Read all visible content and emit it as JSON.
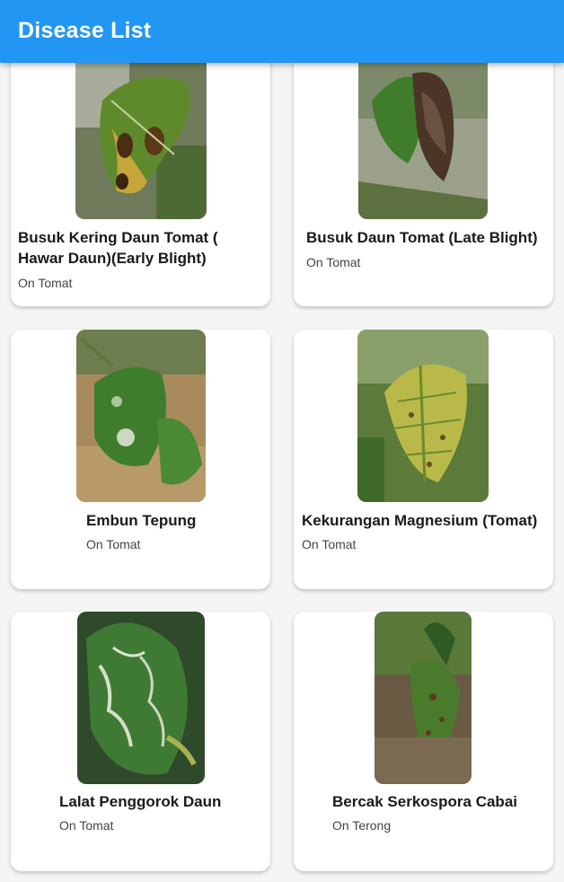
{
  "appbar": {
    "title": "Disease List"
  },
  "cards": [
    {
      "title": "Busuk Kering Daun Tomat ( Hawar Daun)(Early Blight)",
      "subtitle": "On Tomat"
    },
    {
      "title": "Busuk Daun Tomat (Late Blight)",
      "subtitle": "On Tomat"
    },
    {
      "title": "Embun Tepung",
      "subtitle": "On Tomat"
    },
    {
      "title": "Kekurangan Magnesium (Tomat)",
      "subtitle": "On Tomat"
    },
    {
      "title": "Lalat Penggorok Daun",
      "subtitle": "On Tomat"
    },
    {
      "title": "Bercak Serkospora Cabai",
      "subtitle": "On Terong"
    }
  ],
  "colors": {
    "appbar": "#2196f3",
    "background": "#f5f5f5",
    "card": "#ffffff"
  }
}
